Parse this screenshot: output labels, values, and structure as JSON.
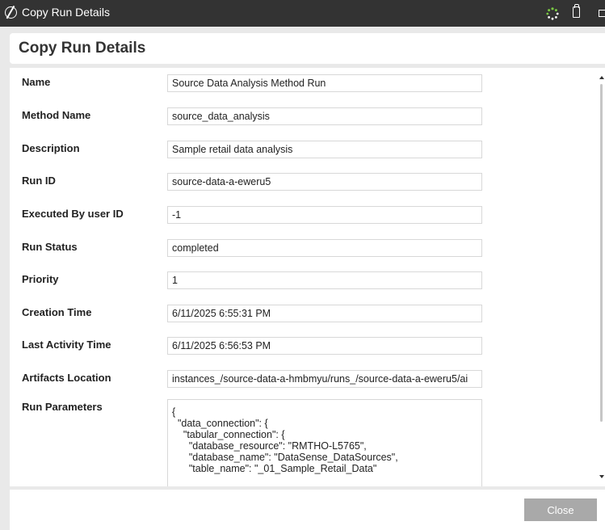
{
  "window": {
    "title": "Copy Run Details"
  },
  "dialog": {
    "title": "Copy Run Details",
    "fields": [
      {
        "label": "Name",
        "value": "Source Data Analysis Method Run"
      },
      {
        "label": "Method Name",
        "value": "source_data_analysis"
      },
      {
        "label": "Description",
        "value": "Sample retail data analysis"
      },
      {
        "label": "Run ID",
        "value": "source-data-a-eweru5"
      },
      {
        "label": "Executed By user ID",
        "value": "-1"
      },
      {
        "label": "Run Status",
        "value": "completed"
      },
      {
        "label": "Priority",
        "value": "1"
      },
      {
        "label": "Creation Time",
        "value": "6/11/2025 6:55:31 PM"
      },
      {
        "label": "Last Activity Time",
        "value": "6/11/2025 6:56:53 PM"
      },
      {
        "label": "Artifacts Location",
        "value": "instances_/source-data-a-hmbmyu/runs_/source-data-a-eweru5/ai"
      }
    ],
    "run_parameters": {
      "label": "Run Parameters",
      "value": "{\n  \"data_connection\": {\n    \"tabular_connection\": {\n      \"database_resource\": \"RMTHO-L5765\",\n      \"database_name\": \"DataSense_DataSources\",\n      \"table_name\": \"_01_Sample_Retail_Data\""
    },
    "close_label": "Close"
  },
  "colors": {
    "titlebar": "#333333",
    "background": "#e9e9e9",
    "close_button": "#a9a9a9"
  },
  "icons": {
    "app": "app-logo-icon",
    "busy": "loading-spinner-icon",
    "clipboard": "clipboard-icon",
    "window": "minimize-window-icon"
  }
}
